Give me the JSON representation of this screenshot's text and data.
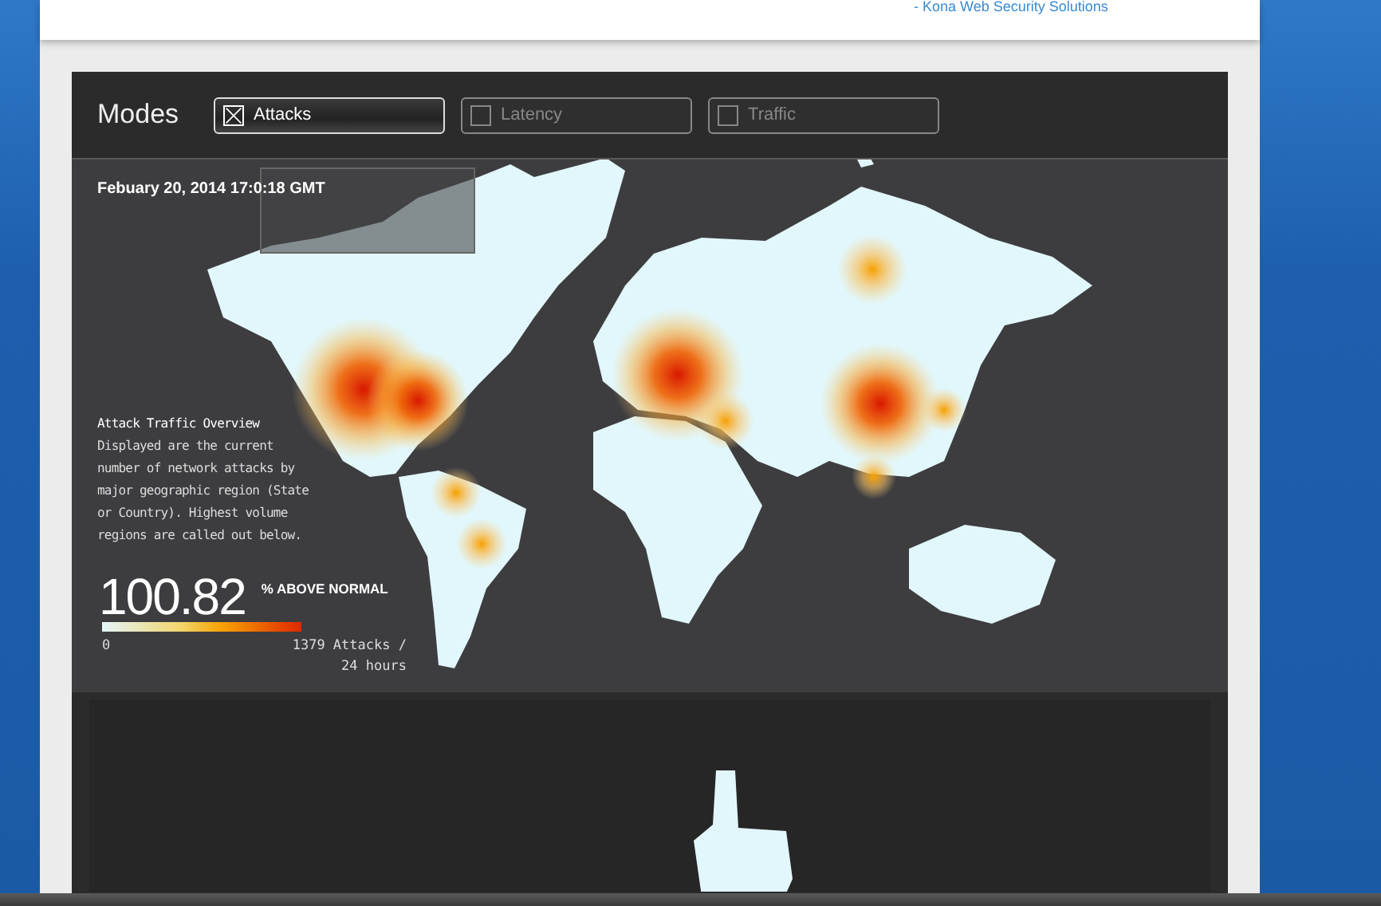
{
  "header": {
    "bullet": "-",
    "link": "Kona Web Security Solutions"
  },
  "modes": {
    "title": "Modes",
    "items": [
      {
        "label": "Attacks",
        "selected": true
      },
      {
        "label": "Latency",
        "selected": false
      },
      {
        "label": "Traffic",
        "selected": false
      }
    ]
  },
  "map": {
    "timestamp": "Febuary 20, 2014 17:0:18 GMT",
    "overview": {
      "title": "Attack Traffic Overview",
      "description": "Displayed are the current number of network attacks by major geographic region (State or Country). Highest volume regions are called out below."
    },
    "metric": {
      "value": "100.82",
      "label": "% ABOVE NORMAL"
    },
    "legend": {
      "min": "0",
      "max": "1379 Attacks / 24 hours"
    }
  }
}
